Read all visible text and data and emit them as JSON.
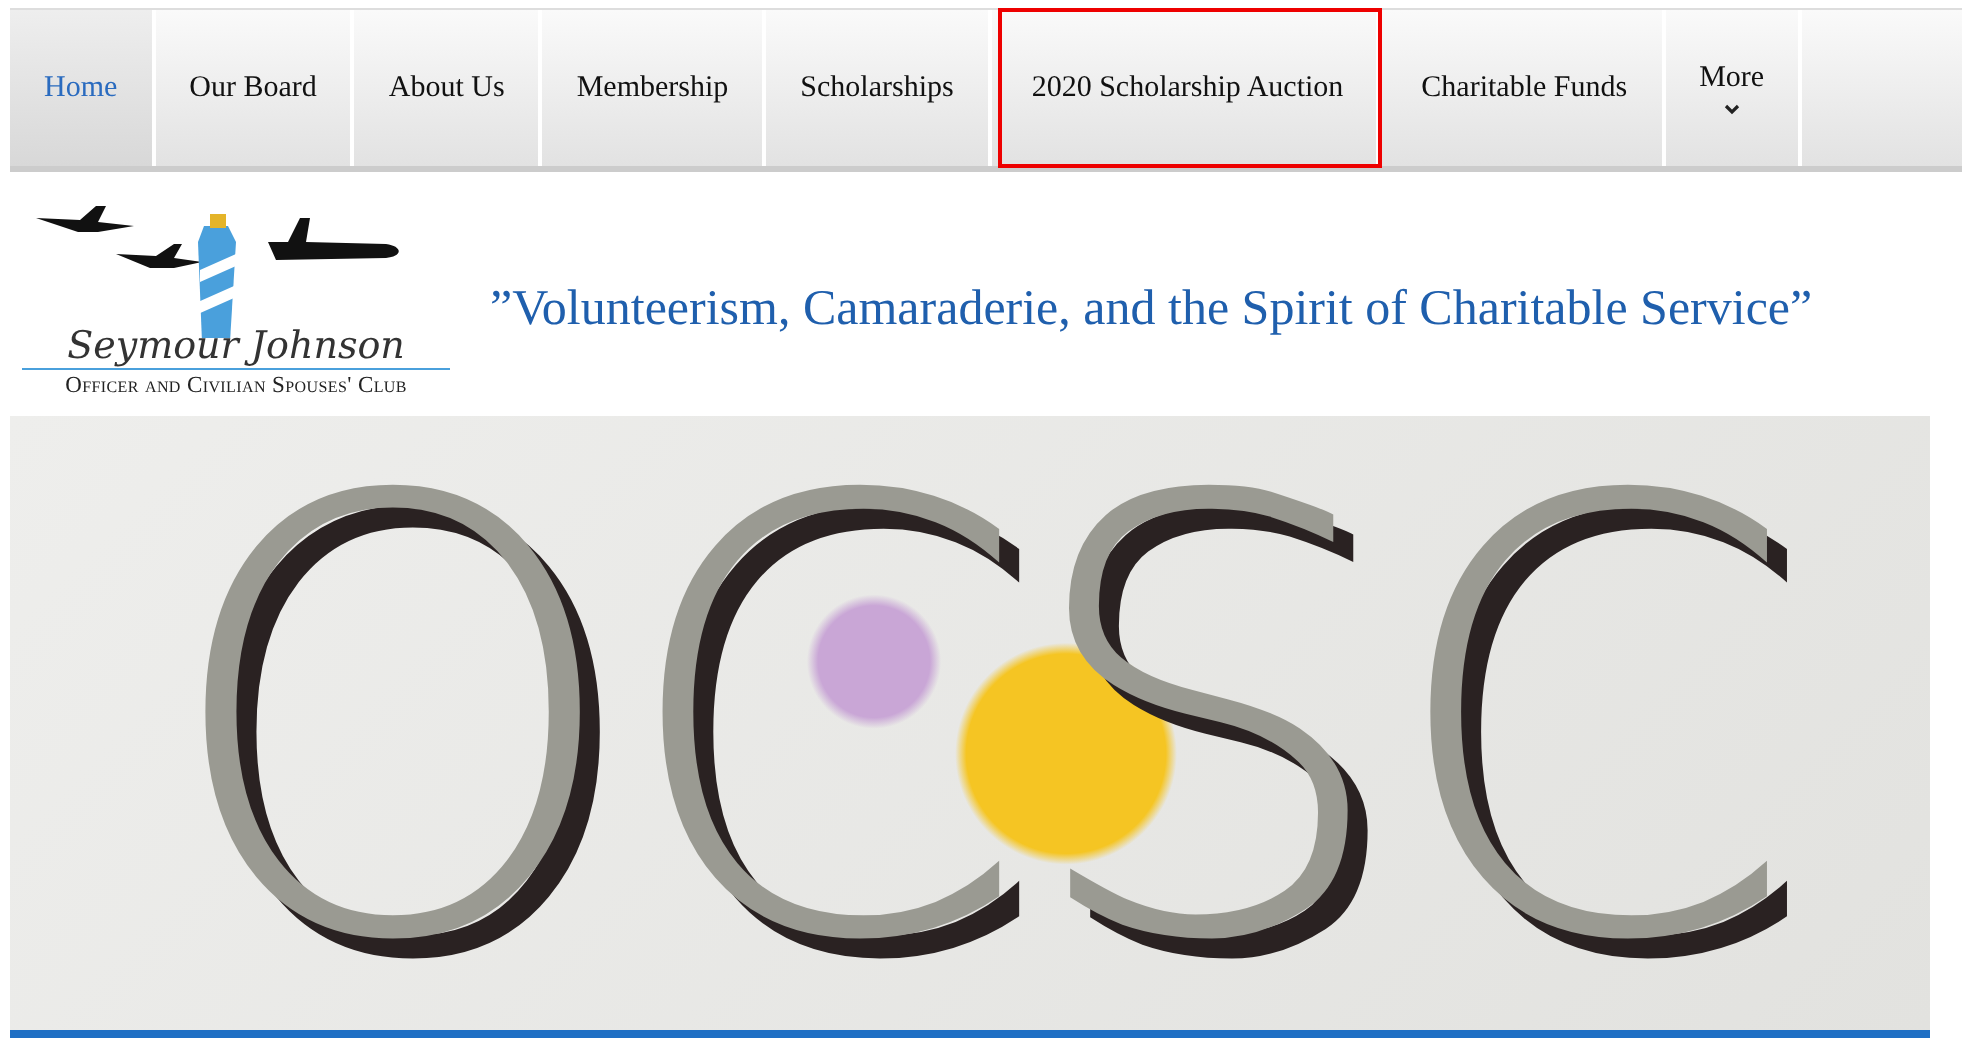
{
  "nav": {
    "tabs": [
      {
        "label": "Home",
        "selected": true,
        "highlighted": false
      },
      {
        "label": "Our Board",
        "selected": false,
        "highlighted": false
      },
      {
        "label": "About Us",
        "selected": false,
        "highlighted": false
      },
      {
        "label": "Membership",
        "selected": false,
        "highlighted": false
      },
      {
        "label": "Scholarships",
        "selected": false,
        "highlighted": false
      },
      {
        "label": "2020 Scholarship Auction",
        "selected": false,
        "highlighted": true
      },
      {
        "label": "Charitable Funds",
        "selected": false,
        "highlighted": false
      },
      {
        "label": "More",
        "selected": false,
        "highlighted": false,
        "kind": "dropdown"
      }
    ]
  },
  "header": {
    "logo": {
      "name": "Seymour Johnson",
      "subtitle": "Officer and Civilian Spouses' Club"
    },
    "tagline": "”Volunteerism, Camaraderie, and the Spirit of Charitable Service”"
  },
  "banner": {
    "title": "OCSC"
  }
}
